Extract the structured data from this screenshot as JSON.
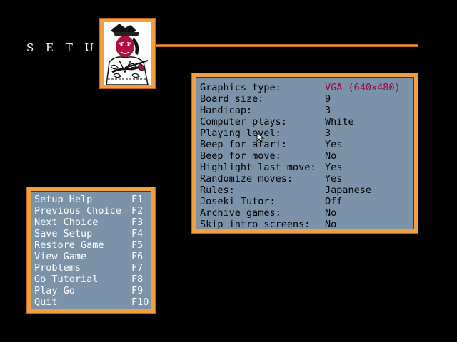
{
  "header": {
    "title": "S E T U P"
  },
  "colors": {
    "frame": "#f0a040",
    "panel": "#7b93a8",
    "accent": "#a8003a",
    "background": "#000000"
  },
  "settings": [
    {
      "label": "Graphics type:",
      "value": "VGA (640x480)",
      "highlight": true
    },
    {
      "label": "Board size:",
      "value": "9"
    },
    {
      "label": "Handicap:",
      "value": "3"
    },
    {
      "label": "Computer plays:",
      "value": "White"
    },
    {
      "label": "Playing level:",
      "value": "3"
    },
    {
      "label": "Beep for atari:",
      "value": "Yes"
    },
    {
      "label": "Beep for move:",
      "value": "No"
    },
    {
      "label": "Highlight last move:",
      "value": "Yes"
    },
    {
      "label": "Randomize moves:",
      "value": "Yes"
    },
    {
      "label": "Rules:",
      "value": "Japanese"
    },
    {
      "label": "Joseki Tutor:",
      "value": "Off"
    },
    {
      "label": "Archive games:",
      "value": "No"
    },
    {
      "label": "Skip intro screens:",
      "value": "No"
    }
  ],
  "menu": [
    {
      "label": "Setup Help",
      "key": "F1"
    },
    {
      "label": "Previous Choice",
      "key": "F2"
    },
    {
      "label": "Next Choice",
      "key": "F3"
    },
    {
      "label": "Save Setup",
      "key": "F4"
    },
    {
      "label": "Restore Game",
      "key": "F5"
    },
    {
      "label": "View Game",
      "key": "F6"
    },
    {
      "label": "Problems",
      "key": "F7"
    },
    {
      "label": "Go Tutorial",
      "key": "F8"
    },
    {
      "label": "Play Go",
      "key": "F9"
    },
    {
      "label": "Quit",
      "key": "F10"
    }
  ],
  "icons": {
    "portrait": "samurai-portrait-icon",
    "cursor": "mouse-pointer-icon"
  }
}
